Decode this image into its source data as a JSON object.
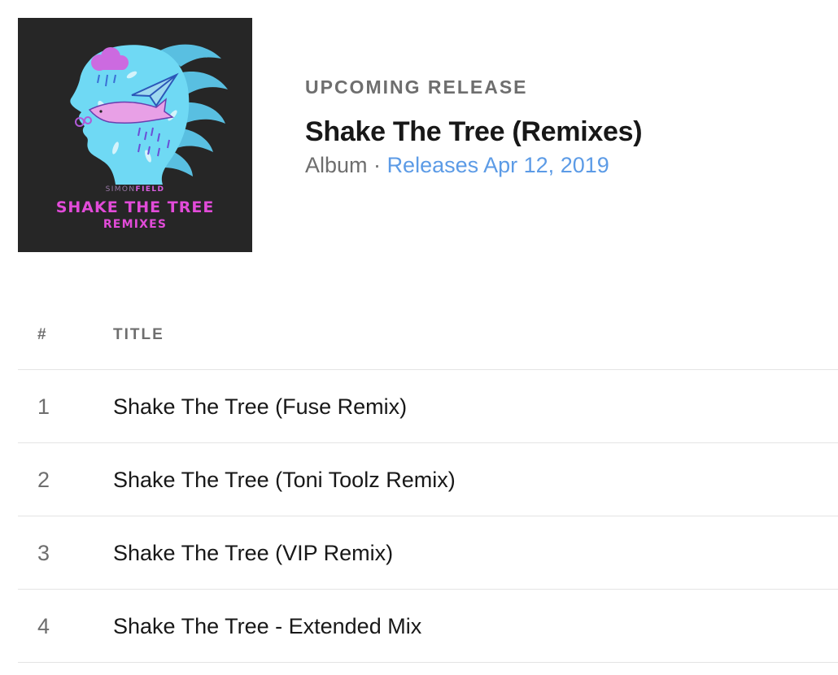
{
  "cover": {
    "artist_first": "SIMON",
    "artist_second": "FIELD",
    "title": "SHAKE THE TREE",
    "subtitle": "REMIXES",
    "colors": {
      "background": "#262626",
      "head": "#6fd9f4",
      "accent": "#e24bd9"
    }
  },
  "header": {
    "eyebrow": "UPCOMING RELEASE",
    "title": "Shake The Tree (Remixes)",
    "type": "Album",
    "separator": "·",
    "release": "Releases Apr 12, 2019"
  },
  "tracklist": {
    "columns": {
      "number": "#",
      "title": "TITLE"
    },
    "tracks": [
      {
        "number": "1",
        "title": "Shake The Tree (Fuse Remix)"
      },
      {
        "number": "2",
        "title": "Shake The Tree (Toni Toolz Remix)"
      },
      {
        "number": "3",
        "title": "Shake The Tree (VIP Remix)"
      },
      {
        "number": "4",
        "title": "Shake The Tree - Extended Mix"
      }
    ]
  },
  "colors": {
    "muted_text": "#6e6e6e",
    "link": "#5c9be6",
    "divider": "#e4e4e4"
  }
}
